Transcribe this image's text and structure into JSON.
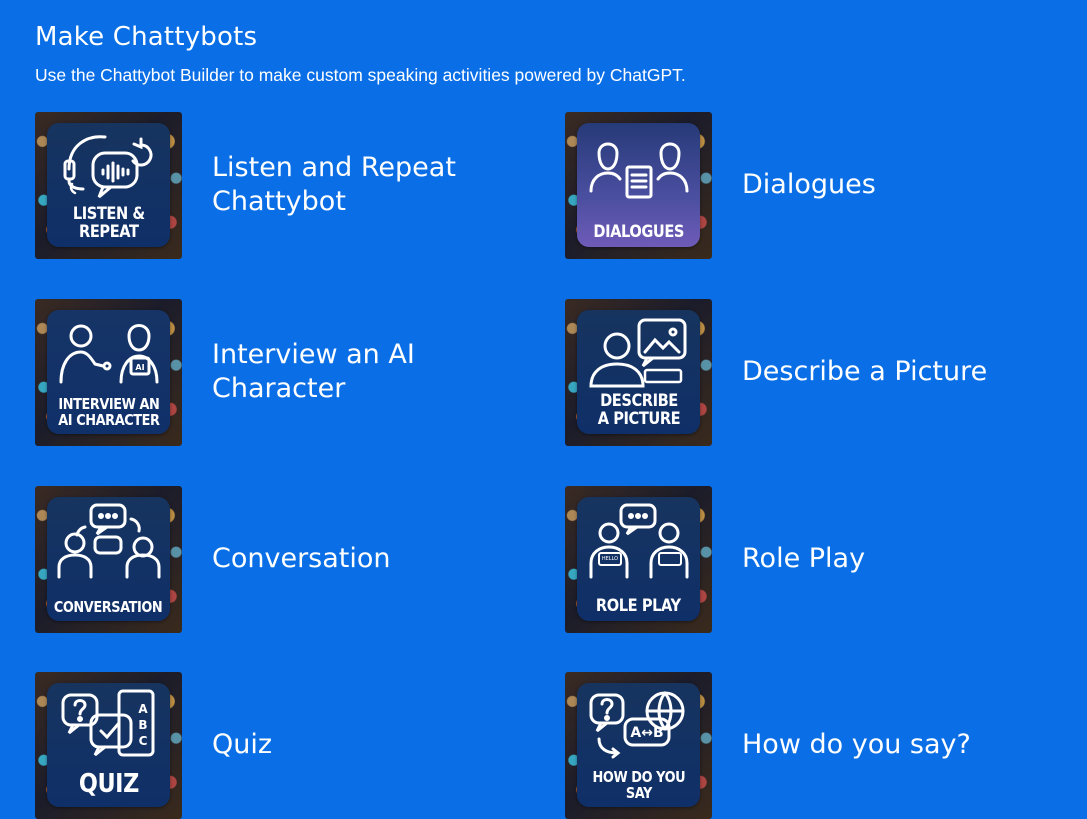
{
  "header": {
    "title": "Make Chattybots",
    "subtitle": "Use the Chattybot Builder to make custom speaking activities powered by ChatGPT."
  },
  "cards": [
    {
      "title": "Listen and Repeat Chattybot",
      "tile_label": "LISTEN &\nREPEAT",
      "icon": "headset-voice-repeat-icon"
    },
    {
      "title": "Dialogues",
      "tile_label": "DIALOGUES",
      "icon": "two-people-dialogue-icon"
    },
    {
      "title": "Interview an AI Character",
      "tile_label": "INTERVIEW AN\nAI CHARACTER",
      "badge": "AI",
      "icon": "interviewer-microphone-icon"
    },
    {
      "title": "Describe a Picture",
      "tile_label": "DESCRIBE\nA PICTURE",
      "icon": "person-picture-icon"
    },
    {
      "title": "Conversation",
      "tile_label": "CONVERSATION",
      "icon": "conversation-bubbles-icon"
    },
    {
      "title": "Role Play",
      "tile_label": "ROLE PLAY",
      "badge": "HELLO",
      "icon": "role-play-nametags-icon"
    },
    {
      "title": "Quiz",
      "tile_label": "QUIZ",
      "icon": "quiz-checkmark-icon"
    },
    {
      "title": "How do you say?",
      "tile_label": "HOW DO YOU\nSAY",
      "badge": "A↔B",
      "icon": "translate-globe-icon"
    }
  ]
}
